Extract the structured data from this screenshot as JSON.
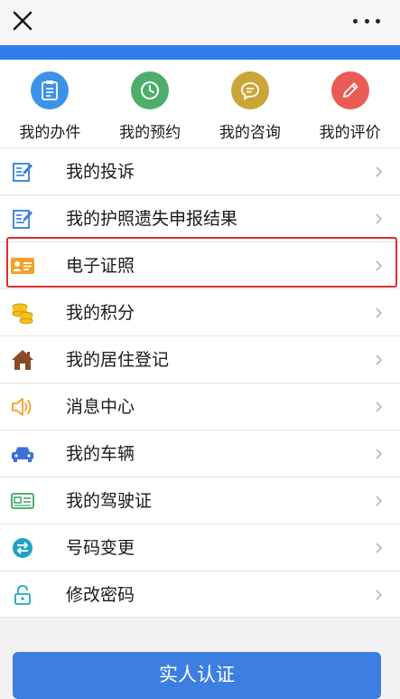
{
  "topbar": {
    "close_icon": "close-icon",
    "more_icon": "more-dots-icon"
  },
  "quick_actions": [
    {
      "label": "我的办件",
      "icon": "clipboard-icon",
      "color": "#3c92e8"
    },
    {
      "label": "我的预约",
      "icon": "clock-icon",
      "color": "#4cae6a"
    },
    {
      "label": "我的咨询",
      "icon": "chat-bubble-icon",
      "color": "#c9a637"
    },
    {
      "label": "我的评价",
      "icon": "pencil-icon",
      "color": "#ea5b55"
    }
  ],
  "menu": [
    {
      "label": "我的投诉",
      "icon": "edit-note-icon"
    },
    {
      "label": "我的护照遗失申报结果",
      "icon": "edit-note-icon"
    },
    {
      "label": "电子证照",
      "icon": "id-card-icon"
    },
    {
      "label": "我的积分",
      "icon": "coins-icon"
    },
    {
      "label": "我的居住登记",
      "icon": "house-icon"
    },
    {
      "label": "消息中心",
      "icon": "speaker-icon"
    },
    {
      "label": "我的车辆",
      "icon": "car-icon"
    },
    {
      "label": "我的驾驶证",
      "icon": "license-card-icon"
    },
    {
      "label": "号码变更",
      "icon": "swap-arrows-icon"
    },
    {
      "label": "修改密码",
      "icon": "lock-icon"
    }
  ],
  "highlighted_item": "电子证照",
  "footer": {
    "auth_button_label": "实人认证"
  },
  "colors": {
    "accent_blue": "#2f7de8",
    "button_blue": "#3d7fe0",
    "highlight_red": "#d9302c"
  }
}
